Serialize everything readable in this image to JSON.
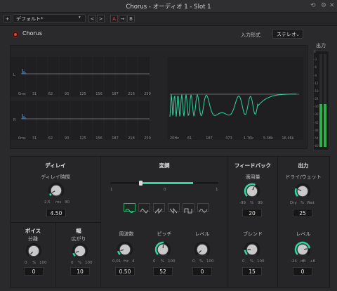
{
  "window": {
    "title": "Chorus - オーディオ 1 - Slot 1"
  },
  "toolbar": {
    "preset": "デフォルト*",
    "compare_a": "A",
    "compare_arrow": "→",
    "compare_b": "B",
    "nav_prev": "<",
    "nav_next": ">"
  },
  "header": {
    "plugin_name": "Chorus",
    "input_format_label": "入力形式",
    "input_format_value": "ステレオ"
  },
  "meter": {
    "label": "出力",
    "scale": [
      "0",
      "-3",
      "-6",
      "-9",
      "-12",
      "-18",
      "-24",
      "-30",
      "-36",
      "-42",
      "-48",
      "-54",
      "-60"
    ]
  },
  "delay_graph": {
    "channel_l": "L",
    "channel_r": "R",
    "ticks": [
      "0ms",
      "31",
      "62",
      "93",
      "125",
      "156",
      "187",
      "218",
      "250"
    ]
  },
  "freq_graph": {
    "ticks": [
      "20Hz",
      "61",
      "187",
      "373",
      "1.76k",
      "5.38k",
      "16.46k"
    ]
  },
  "delay": {
    "title": "ディレイ",
    "param": "ディレイ時間",
    "min": "2.5",
    "unit": "ms",
    "max": "30",
    "value": "4.50"
  },
  "voices": {
    "title": "ボイス",
    "param": "分離",
    "min": "0",
    "unit": "%",
    "max": "100",
    "value": "0"
  },
  "width": {
    "title": "幅",
    "param": "広がり",
    "min": "0",
    "unit": "%",
    "max": "100",
    "value": "10"
  },
  "modulation": {
    "title": "変調",
    "slider_min": "1",
    "slider_mid": "0",
    "slider_max": "1",
    "rate": {
      "label": "周波数",
      "min": "0.01",
      "unit": "Hz",
      "max": "4",
      "value": "0.50"
    },
    "pitch": {
      "label": "ピッチ",
      "min": "0",
      "unit": "%",
      "max": "100",
      "value": "52"
    },
    "level": {
      "label": "レベル",
      "min": "0",
      "unit": "%",
      "max": "100",
      "value": "0"
    }
  },
  "feedback": {
    "title": "フィードバック",
    "amount": {
      "label": "適用量",
      "min": "-99",
      "unit": "%",
      "max": "99",
      "value": "20"
    },
    "blend": {
      "label": "ブレンド",
      "min": "0",
      "unit": "%",
      "max": "100",
      "value": "15"
    }
  },
  "output": {
    "title": "出力",
    "drywet": {
      "label": "ドライ/ウェット",
      "min": "Dry",
      "unit": "%",
      "max": "Wet",
      "value": "25"
    },
    "level": {
      "label": "レベル",
      "min": "-24",
      "unit": "dB",
      "max": "+6",
      "value": "0"
    }
  },
  "colors": {
    "accent": "#2fd6a0",
    "power": "#e0423a",
    "compare_a": "#e0423a"
  }
}
